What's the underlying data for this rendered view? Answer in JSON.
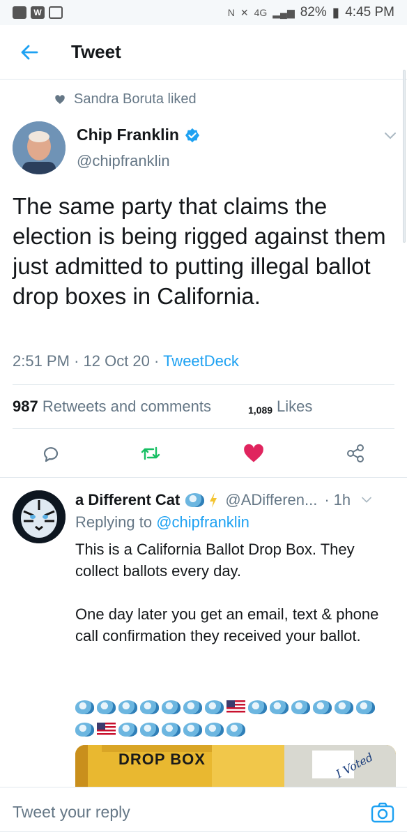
{
  "status_bar": {
    "battery": "82%",
    "time": "4:45 PM",
    "signal_text": "4G"
  },
  "header": {
    "title": "Tweet"
  },
  "tweet": {
    "social_context": "Sandra Boruta liked",
    "author_name": "Chip Franklin",
    "author_handle": "@chipfranklin",
    "text": "The same party that claims the election is being rigged against them just admitted to putting illegal ballot drop boxes in California.",
    "time": "2:51 PM",
    "date": "12 Oct 20",
    "source": "TweetDeck",
    "retweets_count": "987",
    "retweets_label": "Retweets and comments",
    "likes_count": "1,089",
    "likes_label": "Likes"
  },
  "reply": {
    "author_name": "a Different Cat",
    "author_handle": "@ADifferen...",
    "age": "1h",
    "replying_prefix": "Replying to",
    "replying_to": "@chipfranklin",
    "paragraph1": "This is a California Ballot Drop Box. They collect ballots every day.",
    "paragraph2": "One day later you get an email, text & phone call confirmation they received your ballot.",
    "image_sign": "DROP BOX",
    "image_sticker": "I Voted"
  },
  "composer": {
    "placeholder": "Tweet your reply"
  },
  "colors": {
    "accent": "#1da1f2",
    "like": "#e0245e",
    "retweet": "#17bf63",
    "muted": "#657786"
  }
}
